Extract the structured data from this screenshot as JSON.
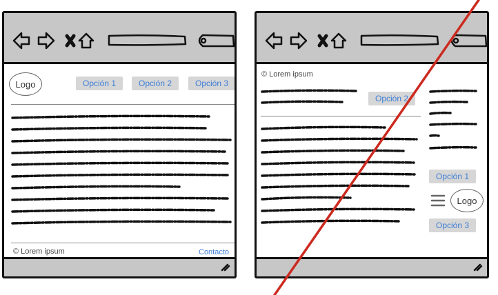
{
  "left": {
    "logo": "Logo",
    "menu": [
      "Opción 1",
      "Opción 2",
      "Opción 3"
    ],
    "footer_copy": "© Lorem ipsum",
    "footer_link": "Contacto"
  },
  "right": {
    "copy_top": "© Lorem ipsum",
    "menu_option_2": "Opción 2",
    "menu_option_1": "Opción 1",
    "logo": "Logo",
    "menu_option_3": "Opción 3"
  },
  "colors": {
    "toolbar": "#c7c7c7",
    "button_bg": "#d6d6d6",
    "link": "#3d7ed6",
    "cross_line": "#cc2a1f"
  },
  "icons": [
    "back-arrow-icon",
    "forward-arrow-icon",
    "close-x-icon",
    "home-icon",
    "search-icon",
    "resize-grip-icon",
    "hamburger-icon"
  ]
}
